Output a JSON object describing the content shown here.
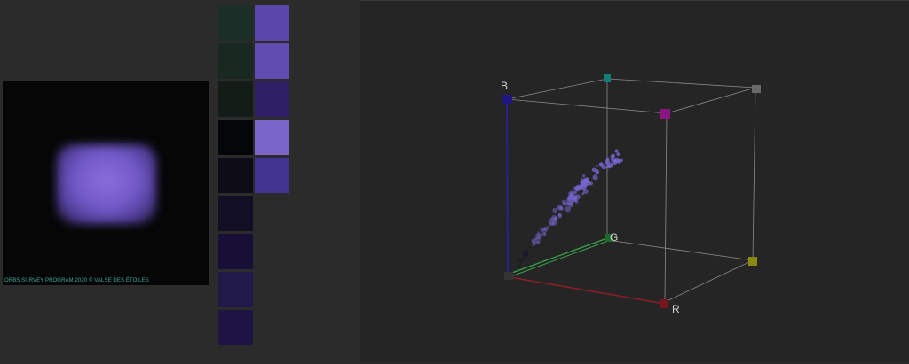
{
  "preview": {
    "caption": "ORBS SURVEY PROGRAM 2020 © VALSE DES ÉTOILES"
  },
  "palette": {
    "column_1": [
      "#1c2e28",
      "#1a2822",
      "#141c18",
      "#050608",
      "#0e0c16",
      "#120e24",
      "#170f35",
      "#21194a",
      "#1d1444"
    ],
    "column_2": [
      "#5a47aa",
      "#5e4cb0",
      "#2e1f66",
      "#7a66c8",
      "#42338f"
    ]
  },
  "cube": {
    "axis_labels": {
      "b": "B",
      "g": "G",
      "r": "R"
    },
    "colors": {
      "r_axis": "#8b1f2a",
      "g_axis": "#3aa54a",
      "b_axis": "#2a2090",
      "edge": "#8a8a8a",
      "points": "#7a6ad8"
    },
    "corner_markers": {
      "origin": "#333333",
      "r": "#7a1520",
      "g": "#1f6a2a",
      "b": "#201680",
      "rg": "#8a8a10",
      "rb": "#8a1580",
      "gb": "#157a7a",
      "rgb": "#6a6a6a"
    }
  }
}
